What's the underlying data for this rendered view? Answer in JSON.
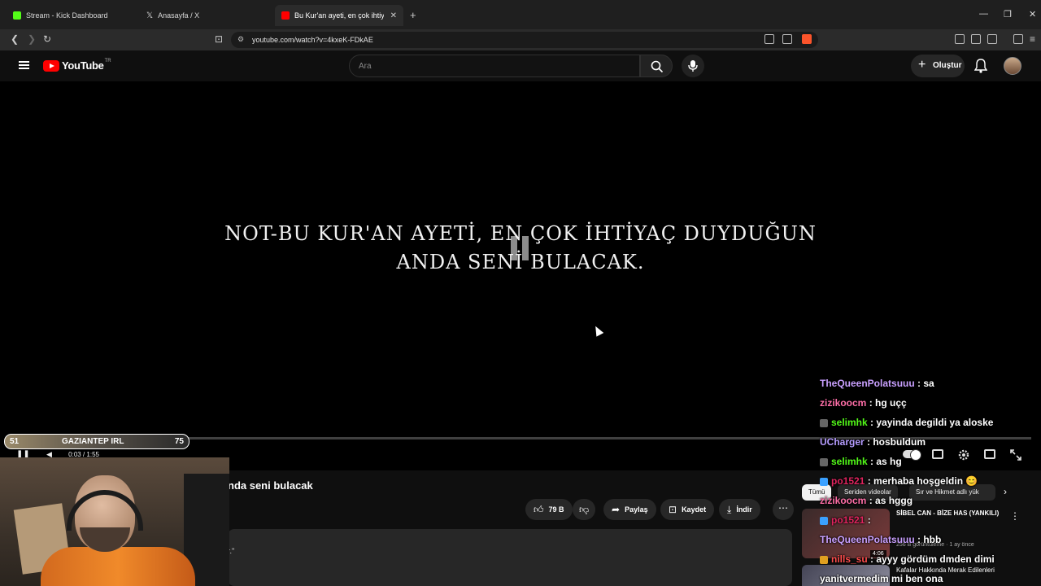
{
  "browser": {
    "tabs": [
      {
        "label": "Stream - Kick Dashboard",
        "color": "#53fc18"
      },
      {
        "label": "Anasayfa / X",
        "color": "#ffffff"
      },
      {
        "label": "Bu Kur'an ayeti, en çok ihtiyaç",
        "color": "#ff0000"
      }
    ],
    "url": "youtube.com/watch?v=4kxeK-FDkAE"
  },
  "youtube": {
    "logo_text": "YouTube",
    "country": "TR",
    "search_placeholder": "Ara",
    "create_label": "Oluştur"
  },
  "video": {
    "overlay_text_line1": "NOT-BU KUR'AN AYETİ, EN ÇOK İHTİYAÇ DUYDUĞUN",
    "overlay_text_line2": "ANDA SENİ BULACAK.",
    "time": "0:03 / 1:55",
    "progress": 0.026,
    "title_partial": "nda seni bulacak",
    "likes": "79 B",
    "share": "Paylaş",
    "save": "Kaydet",
    "download": "İndir",
    "desc_partial": "r.\""
  },
  "stream_hud": {
    "left": "51",
    "center": "GAZIANTEP IRL",
    "right": "75"
  },
  "chips": [
    "Tümü",
    "Seriden videolar",
    "Sır ve Hikmet adlı yük"
  ],
  "recommendations": [
    {
      "title": "SİBEL CAN - BİZE HAS (YANKILI)",
      "meta": "256 B görüntüleme · 1 ay önce",
      "duration": "4:06"
    },
    {
      "title": "Kafalar Hakkında Merak Edilenleri"
    }
  ],
  "chat": [
    {
      "user": "TheQueenPolatsuuu",
      "text": ": sa",
      "color": "#c9a0ff"
    },
    {
      "user": "zizikoocm",
      "text": ": hg uçç",
      "color": "#ff6fa8"
    },
    {
      "user": "selimhk",
      "text": ": yayinda degildi ya aloske",
      "color": "#53fc18"
    },
    {
      "user": "UCharger",
      "text": ": hosbuldum",
      "color": "#b59cff"
    },
    {
      "user": "selimhk",
      "text": ": as hg",
      "color": "#53fc18"
    },
    {
      "user": "po1521",
      "text": ": merhaba hoşgeldin 😊",
      "color": "#e0245e"
    },
    {
      "user": "zizikoocm",
      "text": ": as hggg",
      "color": "#ff6fa8"
    },
    {
      "user": "po1521",
      "text": ":",
      "color": "#e0245e"
    },
    {
      "user": "TheQueenPolatsuuu",
      "text": ": hbb",
      "color": "#c9a0ff"
    },
    {
      "user": "nills_su",
      "text": ": ayyy gördüm dmden dimi",
      "color": "#ff4d4d"
    },
    {
      "user": "yanitvermedim",
      "text": "mi ben ona",
      "color": "#ffffff"
    }
  ]
}
